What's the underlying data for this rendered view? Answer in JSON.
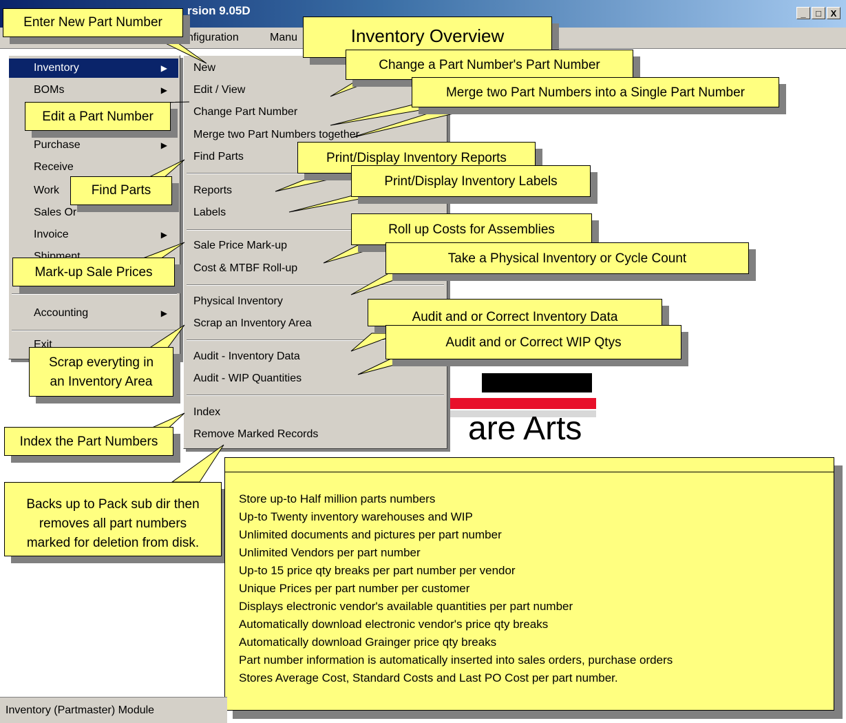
{
  "window": {
    "title": "rsion 9.05D",
    "btn_min": "_",
    "btn_max": "□",
    "btn_close": "X"
  },
  "menubar": {
    "configuration": "nfiguration",
    "manu": "Manu"
  },
  "main_menu": {
    "items": [
      "Inventory",
      "BOMs",
      "",
      "Purchase",
      "Receive",
      "Work",
      "Sales Or",
      "Invoice",
      "Shipment",
      "",
      "Accounting",
      "",
      "Exit"
    ]
  },
  "inventory_menu": {
    "new": "New",
    "edit_view": "Edit / View",
    "change_part_number": "Change Part Number",
    "merge": "Merge two Part Numbers together",
    "find_parts": "Find Parts",
    "reports": "Reports",
    "labels": "Labels",
    "sale_price_markup": "Sale Price Mark-up",
    "cost_rollup": "Cost & MTBF Roll-up",
    "physical_inventory": "Physical Inventory",
    "scrap_area": "Scrap an Inventory Area",
    "audit_inventory": "Audit - Inventory Data",
    "audit_wip": "Audit - WIP Quantities",
    "index": "Index",
    "remove_marked": "Remove Marked Records"
  },
  "callouts": {
    "overview": "Inventory Overview",
    "enter_new": "Enter New Part Number",
    "change_pn": "Change a Part Number's Part Number",
    "merge": "Merge two Part Numbers into a Single Part Number",
    "edit": "Edit a Part Number",
    "find": "Find Parts",
    "reports": "Print/Display Inventory Reports",
    "labels": "Print/Display Inventory Labels",
    "rollup": "Roll up Costs for Assemblies",
    "markup": "Mark-up Sale Prices",
    "physical": "Take a Physical Inventory or Cycle Count",
    "audit_inv": "Audit and or Correct Inventory Data",
    "audit_wip": "Audit and or Correct WIP Qtys",
    "scrap_1": "Scrap everyting in",
    "scrap_2": "an Inventory Area",
    "index": "Index the Part Numbers",
    "backup_1": "Backs up to Pack sub dir then",
    "backup_2": "removes all part numbers",
    "backup_3": "marked for deletion from disk."
  },
  "features": [
    "Store up-to Half million parts numbers",
    "Up-to Twenty inventory warehouses and WIP",
    "Unlimited documents and pictures per part number",
    "Unlimited Vendors per part number",
    "Up-to 15 price qty breaks per part number per vendor",
    "Unique Prices per part number per customer",
    "Displays electronic vendor's available quantities per part number",
    "Automatically download electronic vendor's price qty breaks",
    "Automatically download Grainger price qty breaks",
    "Part number information is automatically inserted into sales orders, purchase orders",
    "Stores Average Cost, Standard Costs and Last PO Cost per part number."
  ],
  "logo_text": "are Arts",
  "status": "Inventory (Partmaster) Module"
}
